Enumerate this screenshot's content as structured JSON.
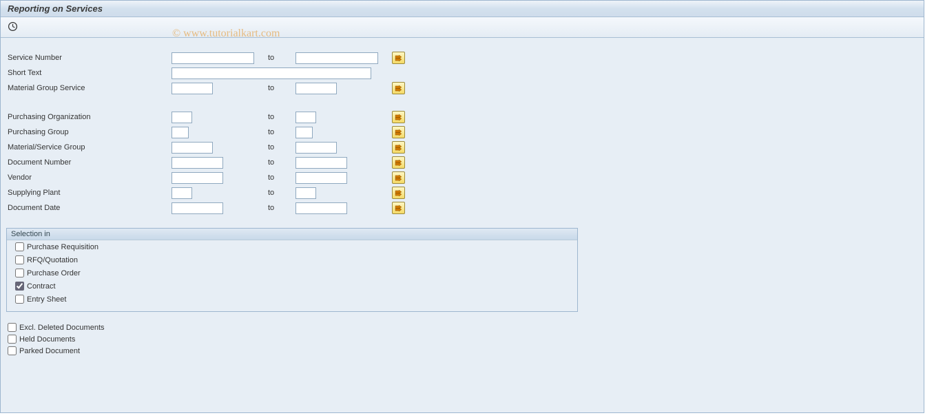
{
  "title": "Reporting on Services",
  "watermark": "© www.tutorialkart.com",
  "labels": {
    "service_number": "Service Number",
    "short_text": "Short Text",
    "material_group_service": "Material Group Service",
    "purchasing_organization": "Purchasing Organization",
    "purchasing_group": "Purchasing Group",
    "material_service_group": "Material/Service Group",
    "document_number": "Document Number",
    "vendor": "Vendor",
    "supplying_plant": "Supplying Plant",
    "document_date": "Document Date",
    "to": "to"
  },
  "values": {
    "service_number_from": "",
    "service_number_to": "",
    "short_text": "",
    "material_group_service_from": "",
    "material_group_service_to": "",
    "purchasing_organization_from": "",
    "purchasing_organization_to": "",
    "purchasing_group_from": "",
    "purchasing_group_to": "",
    "material_service_group_from": "",
    "material_service_group_to": "",
    "document_number_from": "",
    "document_number_to": "",
    "vendor_from": "",
    "vendor_to": "",
    "supplying_plant_from": "",
    "supplying_plant_to": "",
    "document_date_from": "",
    "document_date_to": ""
  },
  "selection_in": {
    "title": "Selection in",
    "items": [
      {
        "label": "Purchase Requisition",
        "checked": false
      },
      {
        "label": "RFQ/Quotation",
        "checked": false
      },
      {
        "label": "Purchase Order",
        "checked": false
      },
      {
        "label": "Contract",
        "checked": true
      },
      {
        "label": "Entry Sheet",
        "checked": false
      }
    ]
  },
  "lower_checks": [
    {
      "label": "Excl. Deleted Documents",
      "checked": false
    },
    {
      "label": "Held Documents",
      "checked": false
    },
    {
      "label": "Parked Document",
      "checked": false
    }
  ]
}
